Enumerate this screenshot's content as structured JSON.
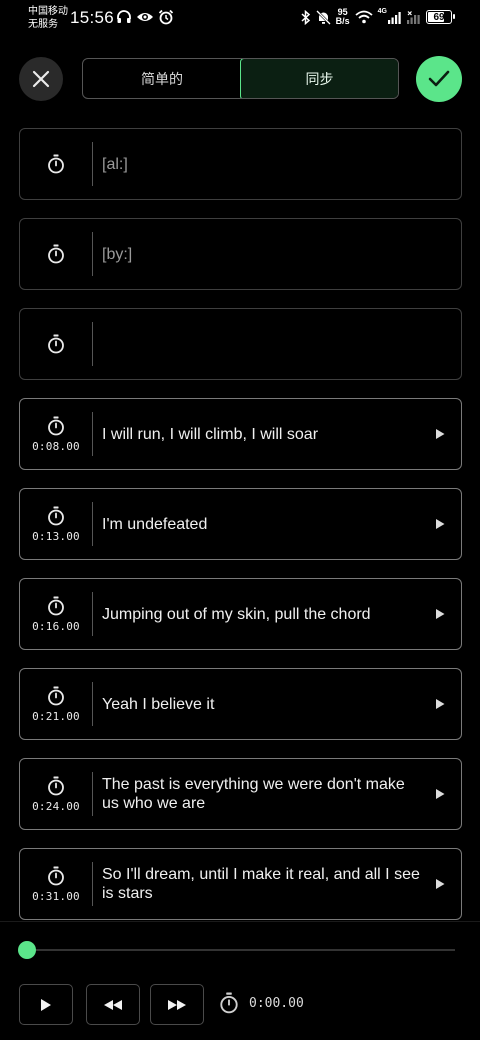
{
  "status_bar": {
    "carrier_line1": "中国移动",
    "carrier_line2": "无服务",
    "time": "15:56",
    "net_speed_value": "95",
    "net_speed_unit": "B/s",
    "network_type": "4G",
    "battery_level": "69",
    "icons": [
      "headphones-icon",
      "eye-icon",
      "alarm-icon",
      "bluetooth-icon",
      "mute-icon",
      "wifi-icon",
      "signal-icon",
      "no-signal-icon",
      "battery-icon"
    ]
  },
  "header": {
    "close_icon": "close-icon",
    "tabs": [
      {
        "label": "简单的",
        "active": false
      },
      {
        "label": "同步",
        "active": true
      }
    ],
    "confirm_icon": "check-icon"
  },
  "lyrics": [
    {
      "time": "",
      "text": "[al:]",
      "placeholder": true,
      "has_play": false
    },
    {
      "time": "",
      "text": "[by:]",
      "placeholder": true,
      "has_play": false
    },
    {
      "time": "",
      "text": "",
      "placeholder": true,
      "has_play": false
    },
    {
      "time": "0:08.00",
      "text": "I will run, I will climb, I will soar",
      "placeholder": false,
      "has_play": true
    },
    {
      "time": "0:13.00",
      "text": "I'm undefeated",
      "placeholder": false,
      "has_play": true
    },
    {
      "time": "0:16.00",
      "text": "Jumping out of my skin, pull the chord",
      "placeholder": false,
      "has_play": true
    },
    {
      "time": "0:21.00",
      "text": "Yeah I believe it",
      "placeholder": false,
      "has_play": true
    },
    {
      "time": "0:24.00",
      "text": "The past is everything we were don't make us who we are",
      "placeholder": false,
      "has_play": true
    },
    {
      "time": "0:31.00",
      "text": "So I'll dream, until I make it real, and all I see is stars",
      "placeholder": false,
      "has_play": true
    }
  ],
  "player": {
    "progress": 0,
    "position": "0:00.00",
    "controls": [
      "play-icon",
      "rewind-icon",
      "fast-forward-icon"
    ],
    "accent_color": "#5be58a"
  }
}
